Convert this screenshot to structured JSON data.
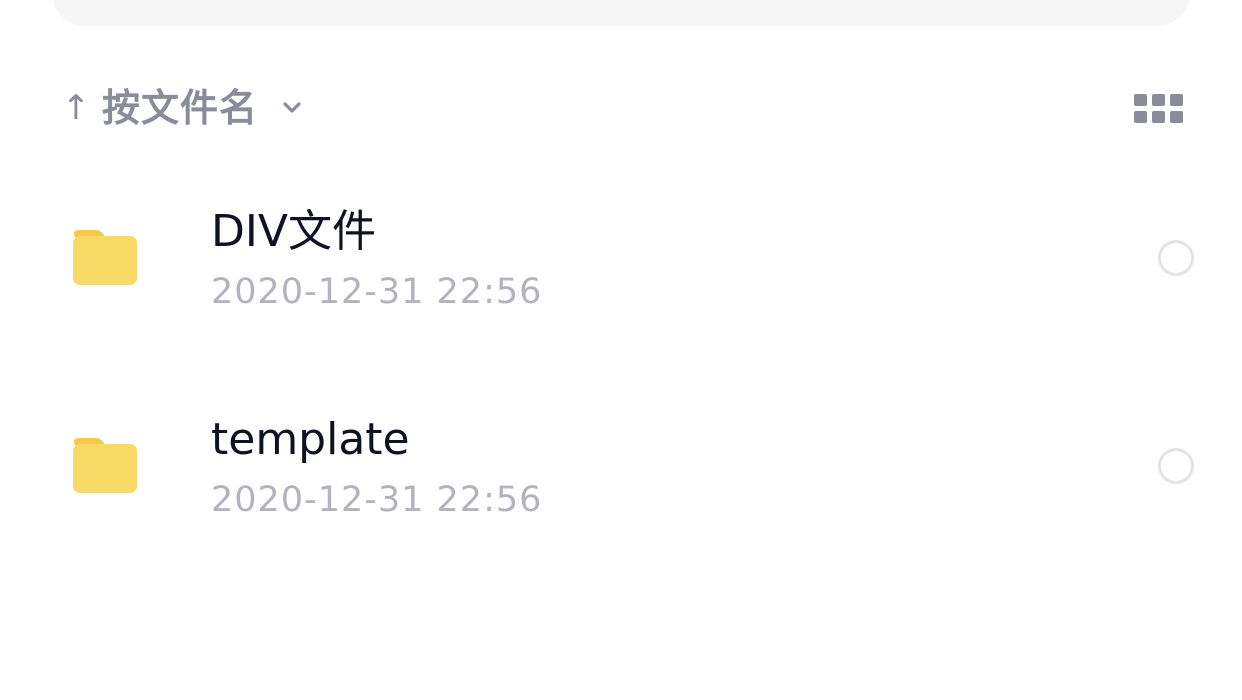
{
  "sort": {
    "direction_icon": "arrow-up-icon",
    "arrow_glyph": "↑",
    "label": "按文件名",
    "dropdown_icon": "chevron-down-icon"
  },
  "view_toggle": {
    "icon": "grid-view-icon"
  },
  "files": [
    {
      "type": "folder",
      "icon": "folder-icon",
      "name": "DIV文件",
      "modified": "2020-12-31 22:56"
    },
    {
      "type": "folder",
      "icon": "folder-icon",
      "name": "template",
      "modified": "2020-12-31 22:56"
    }
  ],
  "colors": {
    "folder": "#f9d965",
    "folder_tab": "#f2c94c",
    "primary_text": "#0f1222",
    "secondary_text": "#b2b3bd",
    "control_gray": "#8a8c99",
    "radio_border": "#e2e3e7"
  }
}
